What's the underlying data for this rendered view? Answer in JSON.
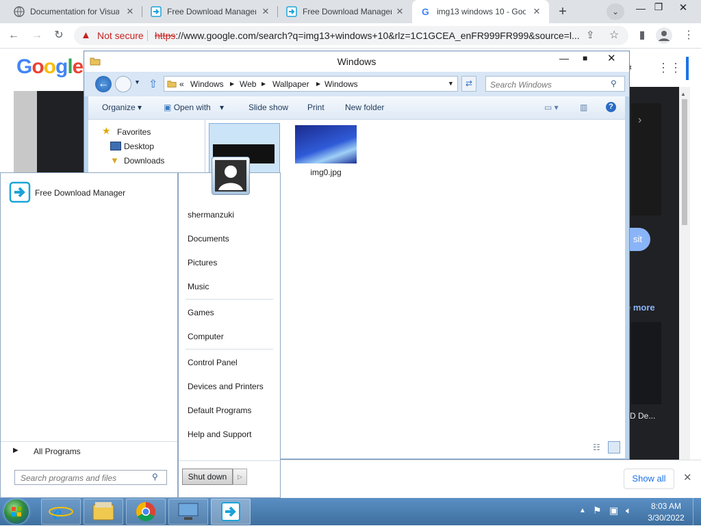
{
  "browser": {
    "tabs": [
      {
        "title": "Documentation for Visua",
        "icon": "globe-icon"
      },
      {
        "title": "Free Download Manager",
        "icon": "fdm-icon"
      },
      {
        "title": "Free Download Manager",
        "icon": "fdm-icon"
      },
      {
        "title": "img13 windows 10 - Goo",
        "icon": "google-icon"
      }
    ],
    "security_label": "Not secure",
    "url_scheme": "https",
    "url_rest": "://www.google.com/search?q=img13+windows+10&rlz=1C1GCEA_enFR999FR999&source=l...",
    "google_logo": "Google",
    "partial_visit": "sit",
    "partial_more": "e more",
    "partial_caption": "D De...",
    "show_all": "Show all"
  },
  "explorer": {
    "title": "Windows",
    "breadcrumb": [
      "«",
      "Windows",
      "Web",
      "Wallpaper",
      "Windows"
    ],
    "search_placeholder": "Search Windows",
    "commands": [
      "Organize",
      "Open with",
      "Slide show",
      "Print",
      "New folder"
    ],
    "nav": {
      "favorites": "Favorites",
      "items": [
        "Desktop",
        "Downloads"
      ]
    },
    "files": [
      {
        "name": "img0.jpg"
      }
    ]
  },
  "start_menu": {
    "pinned": [
      {
        "label": "Free Download Manager"
      }
    ],
    "all_programs": "All Programs",
    "search_placeholder": "Search programs and files",
    "right_items": [
      "shermanzuki",
      "Documents",
      "Pictures",
      "Music",
      "Games",
      "Computer",
      "Control Panel",
      "Devices and Printers",
      "Default Programs",
      "Help and Support"
    ],
    "shutdown": "Shut down"
  },
  "taskbar": {
    "apps": [
      "internet-explorer-icon",
      "file-explorer-icon",
      "chrome-icon",
      "network-icon",
      "fdm-icon"
    ],
    "time": "8:03 AM",
    "date": "3/30/2022"
  },
  "colors": {
    "chrome_tab_strip": "#dee1e6",
    "not_secure_red": "#c5221f",
    "google_blue": "#4285f4",
    "taskbar_blue": "#4a7fb3",
    "start_menu_border": "#8fa7c1"
  }
}
